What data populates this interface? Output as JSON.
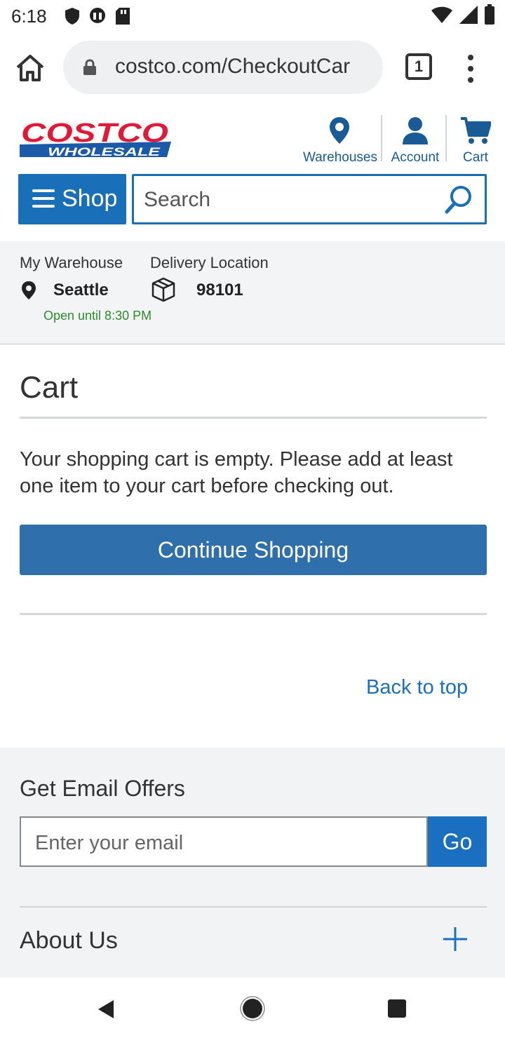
{
  "status_bar": {
    "time": "6:18"
  },
  "browser": {
    "url": "costco.com/CheckoutCar",
    "tab_count": "1"
  },
  "header": {
    "logo_text": "COSTCO",
    "logo_subtext": "WHOLESALE",
    "warehouses_label": "Warehouses",
    "account_label": "Account",
    "cart_label": "Cart",
    "shop_label": "Shop",
    "search_placeholder": "Search"
  },
  "location": {
    "warehouse_label": "My Warehouse",
    "warehouse_value": "Seattle",
    "warehouse_hours": "Open until 8:30 PM",
    "delivery_label": "Delivery Location",
    "delivery_value": "98101"
  },
  "cart": {
    "title": "Cart",
    "empty_message": "Your shopping cart is empty. Please add at least one item to your cart before checking out.",
    "continue_label": "Continue Shopping",
    "back_to_top": "Back to top"
  },
  "footer": {
    "email_heading": "Get Email Offers",
    "email_placeholder": "Enter your email",
    "go_label": "Go",
    "about_label": "About Us"
  },
  "colors": {
    "brand_blue": "#1a70b8",
    "brand_red": "#e31837",
    "link_blue": "#1a6fc0",
    "open_green": "#2e8b2e"
  }
}
